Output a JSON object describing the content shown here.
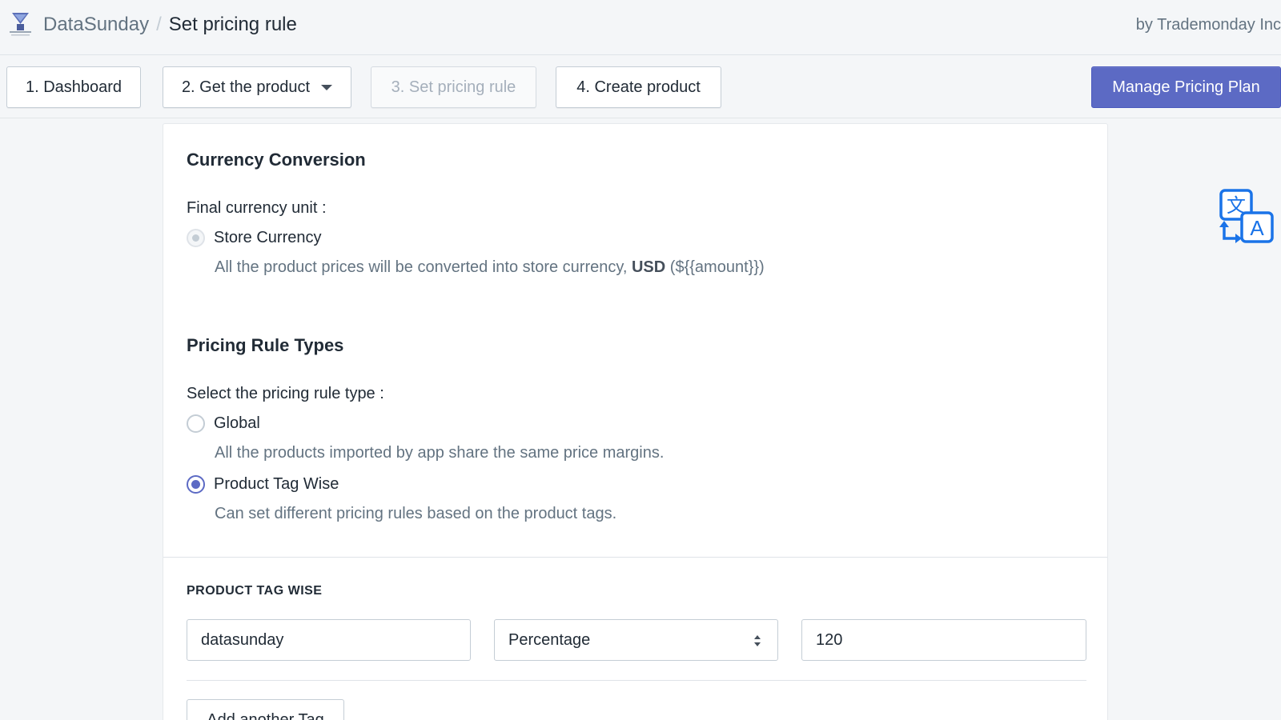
{
  "header": {
    "app_name": "DataSunday",
    "separator": "/",
    "page_title": "Set pricing rule",
    "byline": "by Trademonday Inc"
  },
  "nav": {
    "dashboard": "1. Dashboard",
    "get_product": "2. Get the product",
    "set_pricing": "3. Set pricing rule",
    "create_product": "4. Create product",
    "manage_plan": "Manage Pricing Plan"
  },
  "currency": {
    "title": "Currency Conversion",
    "label": "Final currency unit :",
    "option_label": "Store Currency",
    "help_prefix": "All the product prices will be converted into store currency,",
    "currency_code": "USD",
    "help_suffix": "(${{amount}})"
  },
  "pricing_types": {
    "title": "Pricing Rule Types",
    "label": "Select the pricing rule type :",
    "options": [
      {
        "label": "Global",
        "help": "All the products imported by app share the same price margins.",
        "checked": false
      },
      {
        "label": "Product Tag Wise",
        "help": "Can set different pricing rules based on the product tags.",
        "checked": true
      }
    ]
  },
  "tag_wise": {
    "heading": "PRODUCT TAG WISE",
    "tag_value": "datasunday",
    "type_value": "Percentage",
    "amount_value": "120",
    "add_button": "Add another Tag"
  },
  "colors": {
    "primary": "#5c6ac4",
    "background": "#f4f6f8",
    "text": "#212b36",
    "muted": "#637381",
    "translate_icon": "#1a73e8"
  },
  "icons": {
    "logo": "datasunday-logo-icon",
    "translate": "translate-icon",
    "dropdown": "caret-down-icon",
    "select": "select-arrows-icon"
  }
}
